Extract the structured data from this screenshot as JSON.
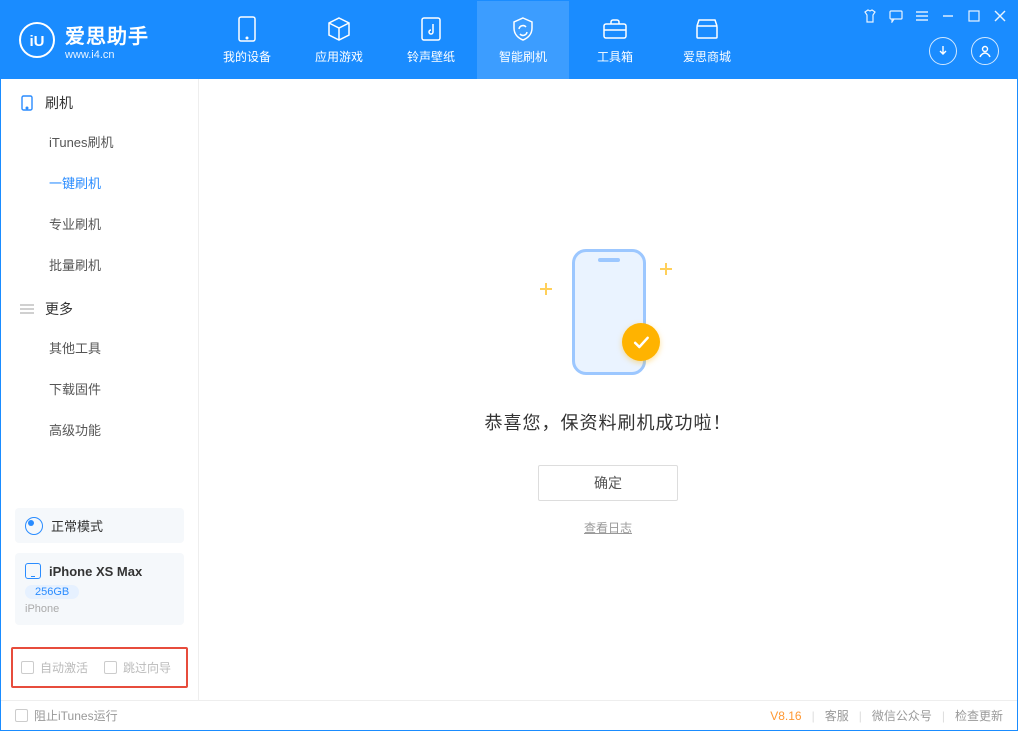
{
  "app": {
    "title": "爱思助手",
    "subtitle": "www.i4.cn"
  },
  "nav": {
    "tabs": [
      {
        "label": "我的设备"
      },
      {
        "label": "应用游戏"
      },
      {
        "label": "铃声壁纸"
      },
      {
        "label": "智能刷机"
      },
      {
        "label": "工具箱"
      },
      {
        "label": "爱思商城"
      }
    ]
  },
  "sidebar": {
    "groups": [
      {
        "title": "刷机",
        "items": [
          "iTunes刷机",
          "一键刷机",
          "专业刷机",
          "批量刷机"
        ]
      },
      {
        "title": "更多",
        "items": [
          "其他工具",
          "下载固件",
          "高级功能"
        ]
      }
    ],
    "mode": "正常模式",
    "device": {
      "name": "iPhone XS Max",
      "storage": "256GB",
      "type": "iPhone"
    },
    "opts": [
      "自动激活",
      "跳过向导"
    ]
  },
  "main": {
    "success": "恭喜您，保资料刷机成功啦！",
    "ok": "确定",
    "view_log": "查看日志"
  },
  "footer": {
    "block_itunes": "阻止iTunes运行",
    "version": "V8.16",
    "links": [
      "客服",
      "微信公众号",
      "检查更新"
    ]
  }
}
